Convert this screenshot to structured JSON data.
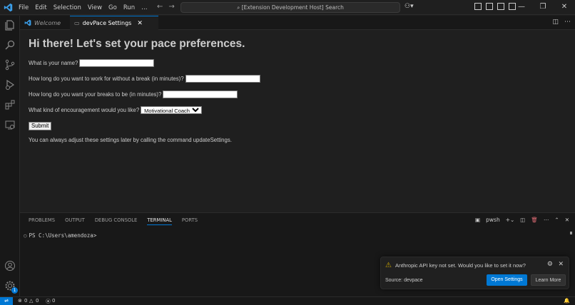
{
  "title_bar": {
    "menu": [
      "File",
      "Edit",
      "Selection",
      "View",
      "Go",
      "Run",
      "…"
    ],
    "command_center": "[Extension Development Host] Search"
  },
  "tabs": {
    "welcome": "Welcome",
    "settings": "devPace Settings"
  },
  "form": {
    "heading": "Hi there! Let's set your pace preferences.",
    "name_label": "What is your name?",
    "work_label": "How long do you want to work for without a break (in minutes)?",
    "break_label": "How long do you want your breaks to be (in minutes)?",
    "encouragement_label": "What kind of encouragement would you like?",
    "encouragement_value": "Motivational Coach",
    "submit_label": "Submit",
    "note": "You can always adjust these settings later by calling the command updateSettings."
  },
  "panel": {
    "tabs": [
      "PROBLEMS",
      "OUTPUT",
      "DEBUG CONSOLE",
      "TERMINAL",
      "PORTS"
    ],
    "active_tab": "TERMINAL",
    "shell_label": "pwsh",
    "prompt": "PS C:\\Users\\amendoza>"
  },
  "notification": {
    "message": "Anthropic API key not set. Would you like to set it now?",
    "source": "Source: devpace",
    "primary_button": "Open Settings",
    "secondary_button": "Learn More"
  },
  "status_bar": {
    "errors": "0",
    "warnings": "0",
    "ports": "0"
  },
  "activity_bar": {
    "settings_badge": "1"
  },
  "colors": {
    "accent": "#0078d4",
    "warning": "#cca700"
  }
}
